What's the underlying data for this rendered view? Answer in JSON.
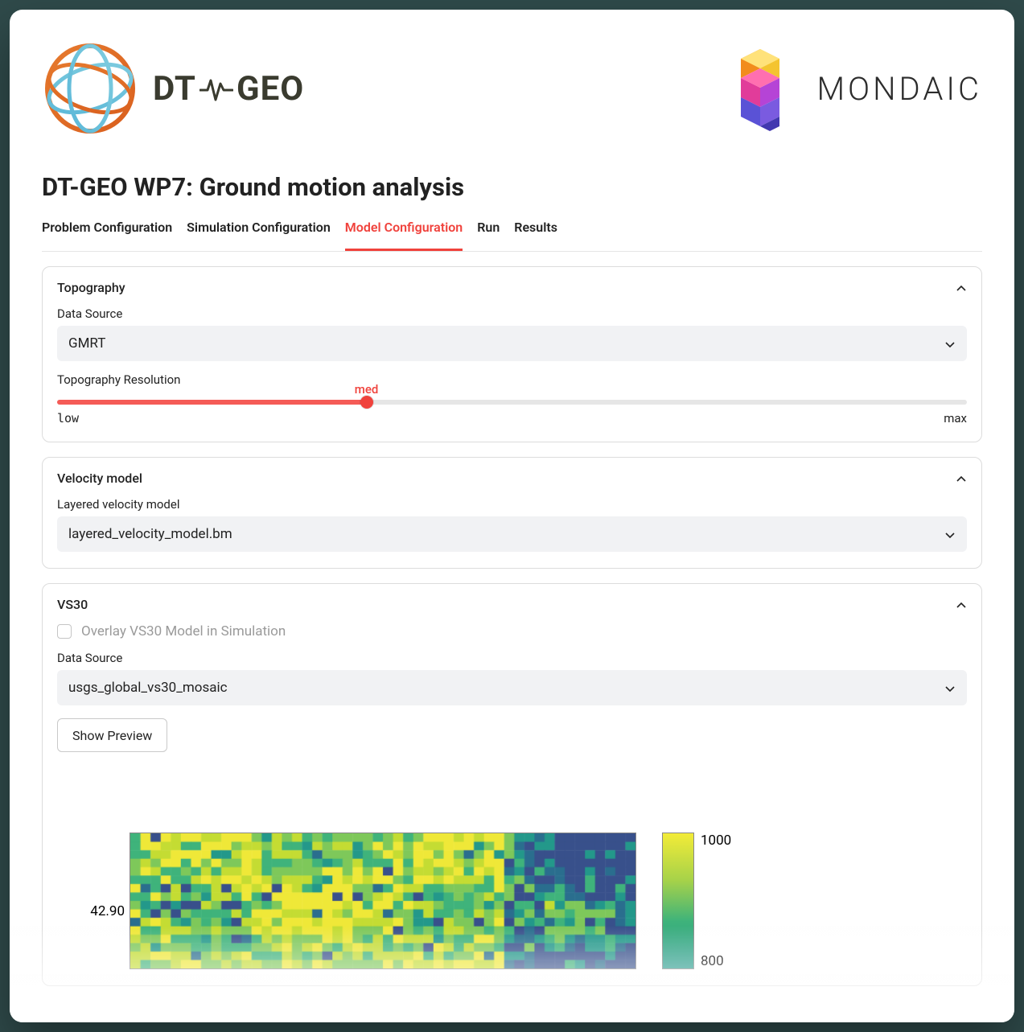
{
  "page_title": "DT-GEO WP7: Ground motion analysis",
  "logos": {
    "left_text_1": "DT",
    "left_text_2": "GEO",
    "right_text": "MONDAIC"
  },
  "tabs": [
    {
      "label": "Problem Configuration",
      "active": false
    },
    {
      "label": "Simulation Configuration",
      "active": false
    },
    {
      "label": "Model Configuration",
      "active": true
    },
    {
      "label": "Run",
      "active": false
    },
    {
      "label": "Results",
      "active": false
    }
  ],
  "cards": {
    "topography": {
      "title": "Topography",
      "data_source_label": "Data Source",
      "data_source_value": "GMRT",
      "resolution_label": "Topography Resolution",
      "resolution_value_label": "med",
      "resolution_min": "low",
      "resolution_max": "max",
      "resolution_fraction": 0.34
    },
    "velocity": {
      "title": "Velocity model",
      "layered_label": "Layered velocity model",
      "layered_value": "layered_velocity_model.bm"
    },
    "vs30": {
      "title": "VS30",
      "overlay_label": "Overlay VS30 Model in Simulation",
      "overlay_checked": false,
      "data_source_label": "Data Source",
      "data_source_value": "usgs_global_vs30_mosaic",
      "preview_button": "Show Preview"
    }
  },
  "chart_data": {
    "type": "heatmap",
    "title": "",
    "xlabel": "",
    "ylabel": "",
    "y_ticks_visible": [
      "42.90"
    ],
    "colorbar_ticks": [
      "1000",
      "800"
    ],
    "colorbar_range": [
      600,
      1000
    ],
    "grid_cols": 50,
    "grid_rows": 16,
    "value_palette_note": "values roughly 600-1000; yellow ~950, green ~750, teal ~600, dark ~500"
  }
}
